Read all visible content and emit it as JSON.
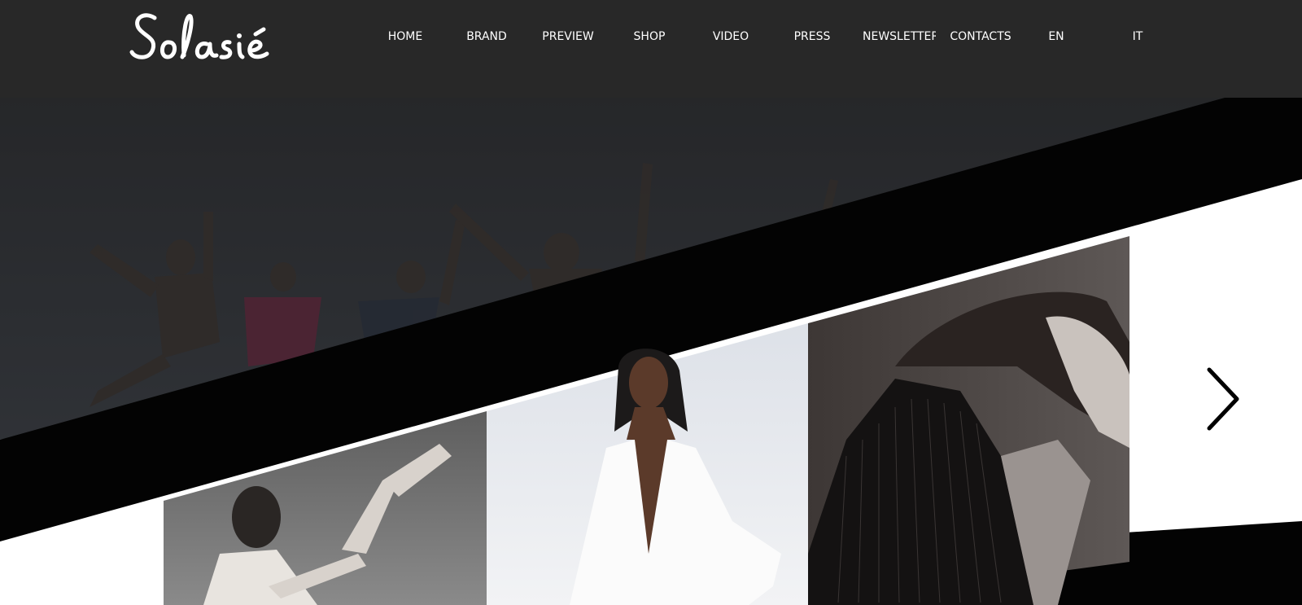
{
  "brand": {
    "logo_text": "Solasié"
  },
  "nav": {
    "items": [
      {
        "label": "HOME"
      },
      {
        "label": "BRAND"
      },
      {
        "label": "PREVIEW"
      },
      {
        "label": "SHOP"
      },
      {
        "label": "VIDEO"
      },
      {
        "label": "PRESS"
      },
      {
        "label": "NEWSLETTER"
      },
      {
        "label": "CONTACTS"
      },
      {
        "label": "EN"
      },
      {
        "label": "IT"
      }
    ]
  },
  "slider": {
    "next_icon": "chevron-right-icon",
    "slides": [
      {
        "icon": "group-jumping-photo"
      },
      {
        "icon": "dancer-photo"
      },
      {
        "icon": "white-dress-model-photo"
      },
      {
        "icon": "pinstripe-jacket-model-photo"
      }
    ]
  },
  "colors": {
    "header_bg": "#282828",
    "band": "#000000",
    "text": "#ffffff"
  }
}
